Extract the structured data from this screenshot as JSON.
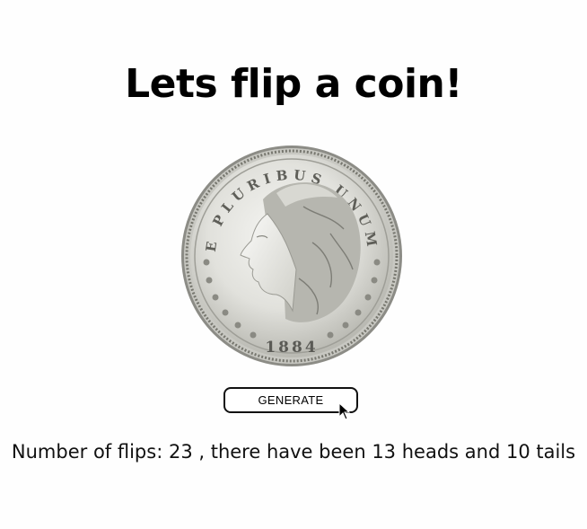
{
  "page": {
    "title": "Lets flip a coin!"
  },
  "coin": {
    "legend": "E PLURIBUS UNUM",
    "year": "1884"
  },
  "controls": {
    "generate_label": "GENERATE"
  },
  "status": {
    "prefix": "Number of flips: ",
    "flips": "23",
    "middle": " , there have been ",
    "heads": "13",
    "heads_suffix": " heads and ",
    "tails": "10",
    "tails_suffix": " tails"
  },
  "colors": {
    "background": "#fefefe",
    "text": "#000000",
    "coin_silver": "#d9d9d4",
    "button_border": "#111111"
  },
  "icons": {
    "cursor": "mouse-pointer-icon"
  }
}
